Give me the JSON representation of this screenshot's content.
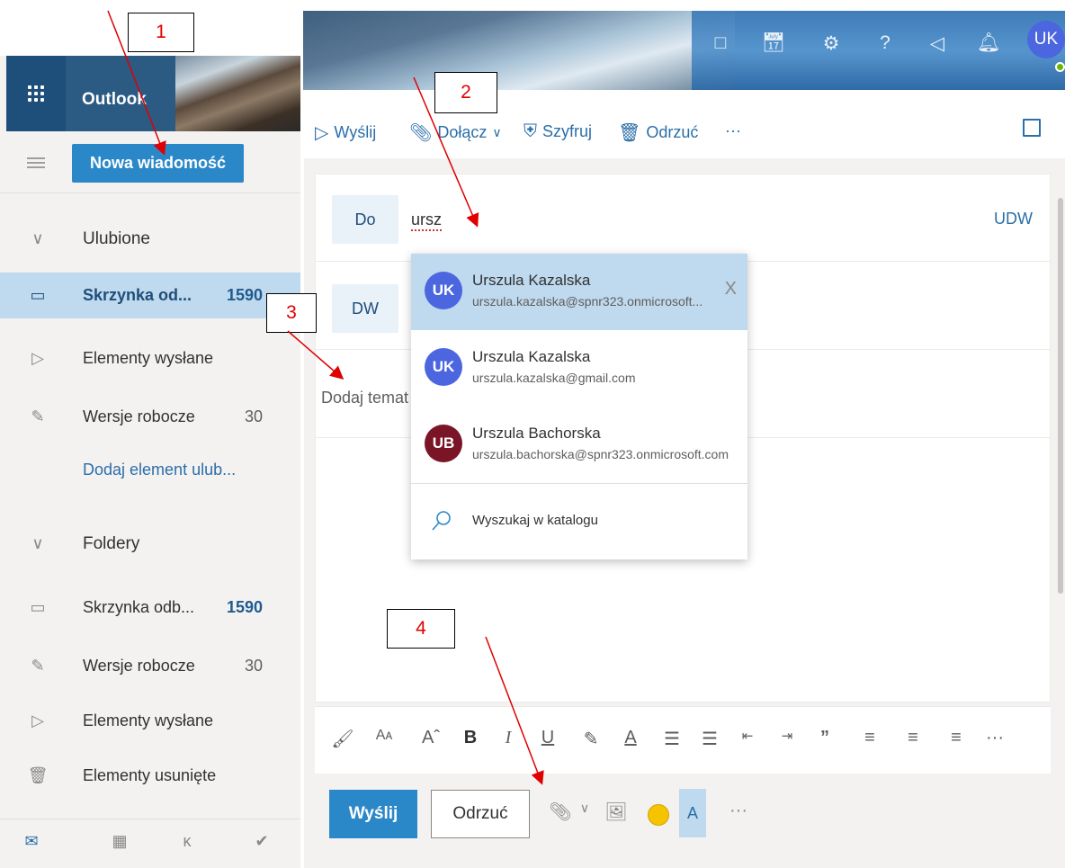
{
  "app": {
    "title": "Outlook"
  },
  "left": {
    "new_message": "Nowa wiadomość",
    "favorites_header": "Ulubione",
    "favorites": [
      {
        "label": "Skrzynka od...",
        "count": "1590",
        "icon": "inbox-icon"
      },
      {
        "label": "Elementy wysłane",
        "count": "",
        "icon": "send-icon"
      },
      {
        "label": "Wersje robocze",
        "count": "30",
        "icon": "pencil-icon"
      }
    ],
    "add_favorite": "Dodaj element ulub...",
    "folders_header": "Foldery",
    "folders": [
      {
        "label": "Skrzynka odb...",
        "count": "1590",
        "icon": "inbox-icon"
      },
      {
        "label": "Wersje robocze",
        "count": "30",
        "icon": "pencil-icon"
      },
      {
        "label": "Elementy wysłane",
        "count": "",
        "icon": "send-icon"
      },
      {
        "label": "Elementy usunięte",
        "count": "",
        "icon": "trash-icon"
      }
    ]
  },
  "topbar": {
    "avatar_initials": "UK"
  },
  "commands": {
    "send": "Wyślij",
    "attach": "Dołącz",
    "encrypt": "Szyfruj",
    "discard": "Odrzuć",
    "more": "···"
  },
  "compose": {
    "to_label": "Do",
    "to_value": "ursz",
    "bcc_label": "UDW",
    "cc_label": "DW",
    "subject_placeholder": "Dodaj temat",
    "send_button": "Wyślij",
    "discard_button": "Odrzuć",
    "more": "···"
  },
  "suggestions": [
    {
      "initials": "UK",
      "name": "Urszula Kazalska",
      "email": "urszula.kazalska@spnr323.onmicrosoft...",
      "color": "#4c66e0",
      "highlighted": true,
      "remove": "X"
    },
    {
      "initials": "UK",
      "name": "Urszula Kazalska",
      "email": "urszula.kazalska@gmail.com",
      "color": "#4c66e0",
      "highlighted": false,
      "remove": ""
    },
    {
      "initials": "UB",
      "name": "Urszula Bachorska",
      "email": "urszula.bachorska@spnr323.onmicrosoft.com",
      "color": "#7a1528",
      "highlighted": false,
      "remove": ""
    }
  ],
  "search_directory": "Wyszukaj w katalogu",
  "annotations": [
    "1",
    "2",
    "3",
    "4"
  ],
  "colors": {
    "accent": "#2b88c8",
    "annotation": "#e00000"
  }
}
